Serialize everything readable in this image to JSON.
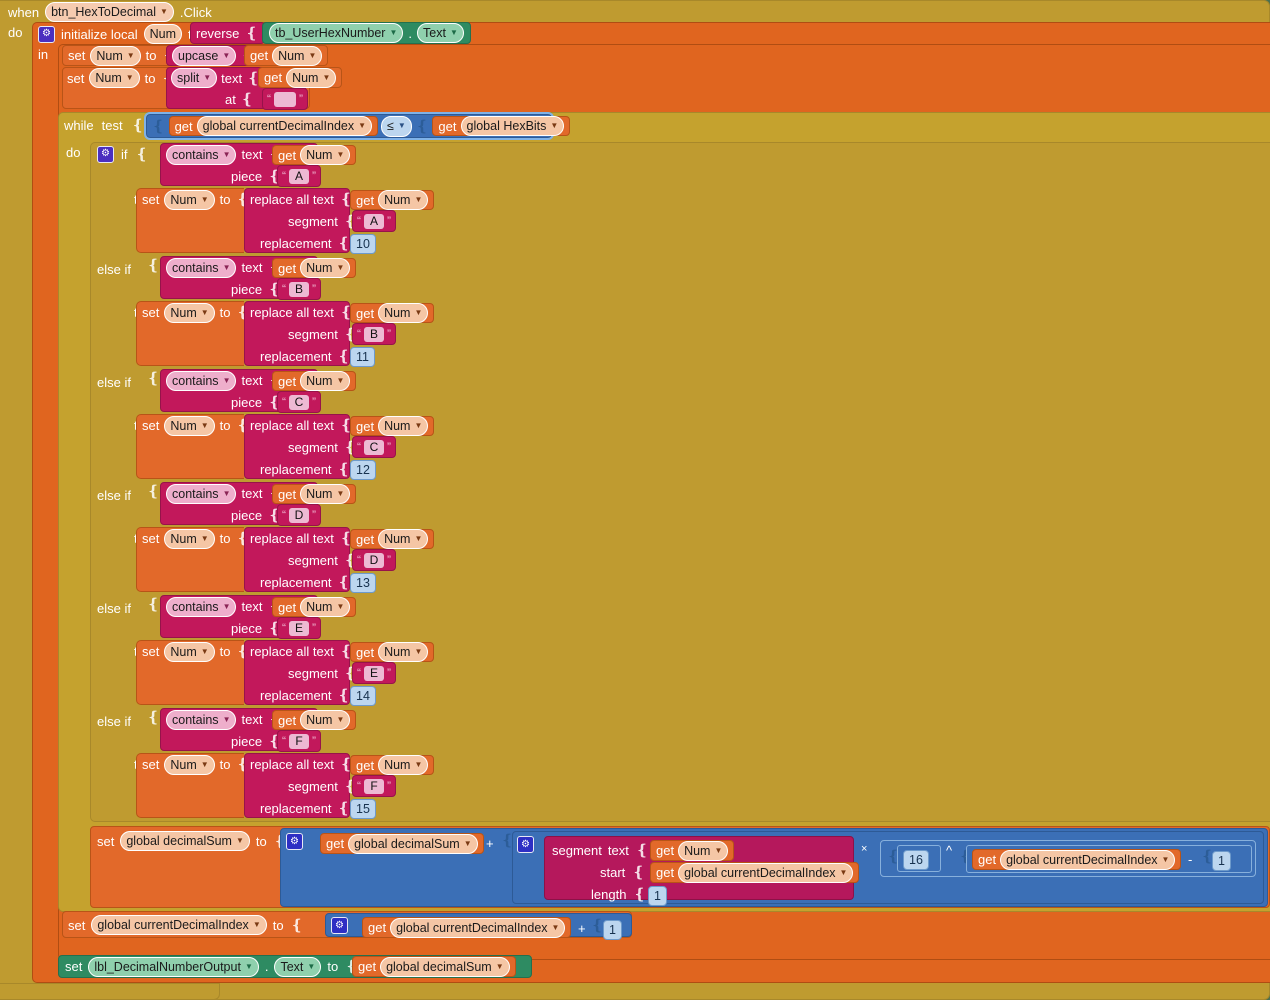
{
  "app": {
    "name": "MIT App Inventor Blocks Editor",
    "canvas_color": "#4a7052"
  },
  "colors": {
    "control": "#bf9b30",
    "variable": "#e0651f",
    "text": "#c2185b",
    "math": "#3b6fb6",
    "component": "#2e8b62",
    "mutator": "#4b2fbf"
  },
  "event": {
    "when_label": "when",
    "component": "btn_HexToDecimal",
    "event_name": ".Click",
    "do_label": "do"
  },
  "local_init": {
    "label": "initialize local",
    "var_name": "Num",
    "to_label": "to",
    "in_label": "in",
    "value": {
      "reverse_label": "reverse",
      "component": "tb_UserHexNumber",
      "dot": ".",
      "property": "Text"
    }
  },
  "statements": {
    "upcase": {
      "set_label": "set",
      "var": "Num",
      "to_label": "to",
      "op": "upcase",
      "get_label": "get",
      "get_var": "Num"
    },
    "split": {
      "set_label": "set",
      "var": "Num",
      "to_label": "to",
      "op": "split",
      "text_label": "text",
      "get_label": "get",
      "get_var": "Num",
      "at_label": "at",
      "at_value": ""
    }
  },
  "while_loop": {
    "while_label": "while",
    "test_label": "test",
    "do_label": "do",
    "condition": {
      "left_get": "get",
      "left_var": "global currentDecimalIndex",
      "operator": "≤",
      "right_get": "get",
      "right_var": "global HexBits"
    }
  },
  "if_chain": {
    "if_label": "if",
    "else_if_label": "else if",
    "then_label": "then",
    "contains_label": "contains",
    "text_label": "text",
    "piece_label": "piece",
    "get_label": "get",
    "get_var": "Num",
    "set_label": "set",
    "set_var": "Num",
    "to_label": "to",
    "replace_label": "replace all text",
    "segment_label": "segment",
    "replacement_label": "replacement",
    "branches": [
      {
        "letter": "A",
        "value": "10"
      },
      {
        "letter": "B",
        "value": "11"
      },
      {
        "letter": "C",
        "value": "12"
      },
      {
        "letter": "D",
        "value": "13"
      },
      {
        "letter": "E",
        "value": "14"
      },
      {
        "letter": "F",
        "value": "15"
      }
    ]
  },
  "sum_statement": {
    "set_label": "set",
    "var": "global decimalSum",
    "to_label": "to",
    "get_label": "get",
    "get_var": "global decimalSum",
    "plus": "+",
    "times": "×",
    "power": "^",
    "minus": "-",
    "segment": {
      "segment_label": "segment",
      "text_label": "text",
      "text_get": "get",
      "text_var": "Num",
      "start_label": "start",
      "start_get": "get",
      "start_var": "global currentDecimalIndex",
      "length_label": "length",
      "length_value": "1"
    },
    "base": "16",
    "exp_get": "get",
    "exp_var": "global currentDecimalIndex",
    "exp_minus_value": "1"
  },
  "increment_statement": {
    "set_label": "set",
    "var": "global currentDecimalIndex",
    "to_label": "to",
    "get_label": "get",
    "get_var": "global currentDecimalIndex",
    "plus": "+",
    "value": "1"
  },
  "output_statement": {
    "set_label": "set",
    "component": "lbl_DecimalNumberOutput",
    "dot": ".",
    "property": "Text",
    "to_label": "to",
    "get_label": "get",
    "get_var": "global decimalSum"
  },
  "icons": {
    "mutator": "⚙",
    "dropdown": "▼"
  }
}
